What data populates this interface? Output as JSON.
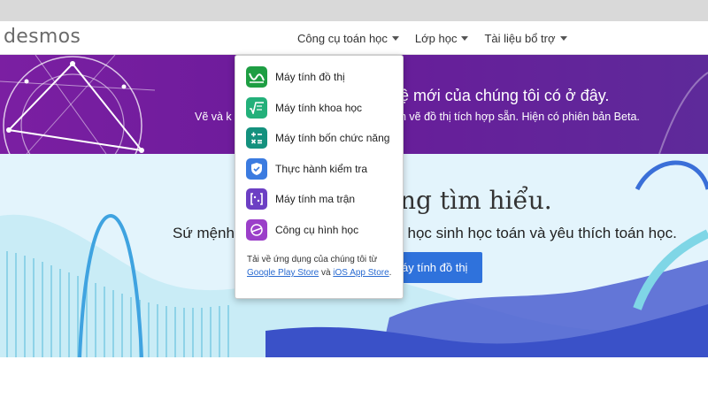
{
  "brand": {
    "logo_text": "desmos"
  },
  "nav": {
    "items": [
      {
        "label": "Công cụ toán học"
      },
      {
        "label": "Lớp học"
      },
      {
        "label": "Tài liệu bổ trợ"
      }
    ]
  },
  "dropdown": {
    "items": [
      {
        "label": "Máy tính đồ thị",
        "icon": "graphing-icon",
        "color": "#1e9e43"
      },
      {
        "label": "Máy tính khoa học",
        "icon": "scientific-icon",
        "color": "#23b07a"
      },
      {
        "label": "Máy tính bốn chức năng",
        "icon": "four-function-icon",
        "color": "#14917e"
      },
      {
        "label": "Thực hành kiểm tra",
        "icon": "test-shield-icon",
        "color": "#3b7be0"
      },
      {
        "label": "Máy tính ma trận",
        "icon": "matrix-icon",
        "color": "#6c3fc4"
      },
      {
        "label": "Công cụ hình học",
        "icon": "geometry-icon",
        "color": "#9b3fc9"
      }
    ],
    "footer": {
      "prefix": "Tải về ứng dụng của chúng tôi từ",
      "google_play": "Google Play Store",
      "and": "và",
      "ios": "iOS App Store",
      "period": "."
    }
  },
  "banner": {
    "title": "ệ mới của chúng tôi có ở đây.",
    "sub_left": "Vẽ và k",
    "sub_right": "h vẽ đồ thị tích hợp sẵn. Hiện có phiên bản Beta."
  },
  "hero": {
    "title": "ng tìm hiểu.",
    "sub_left": "Sứ mệnh",
    "sub_right": "i học sinh học toán và yêu thích toán học.",
    "cta_label": "áy tính đồ thị"
  },
  "colors": {
    "banner": "#6a1b9a",
    "hero_bg": "#e3f4fc",
    "cta": "#2f72dc",
    "link": "#2a6bd1"
  }
}
